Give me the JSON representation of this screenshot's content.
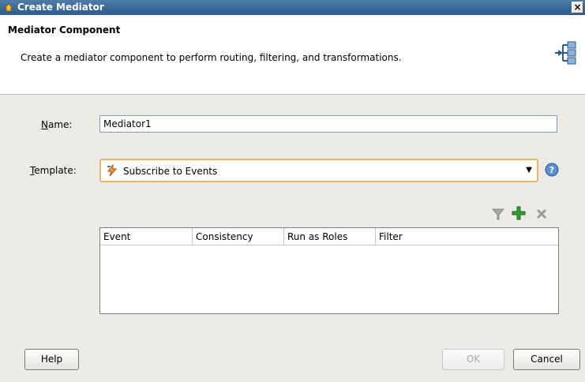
{
  "window": {
    "title": "Create Mediator",
    "close_glyph": "×"
  },
  "header": {
    "title": "Mediator Component",
    "description": "Create a mediator component to perform routing, filtering, and transformations.",
    "icon": "mediator-component-icon"
  },
  "form": {
    "name_label_accel": "N",
    "name_label_rest": "ame:",
    "name_value": "Mediator1",
    "template_label_accel": "T",
    "template_label_rest": "emplate:",
    "template_value": "Subscribe to Events",
    "template_icon": "subscribe-events-icon"
  },
  "toolbar": {
    "icons": [
      "filter-icon",
      "add-icon",
      "delete-icon"
    ]
  },
  "table": {
    "columns": [
      "Event",
      "Consistency",
      "Run as Roles",
      "Filter"
    ],
    "rows": []
  },
  "buttons": {
    "help": "Help",
    "ok": "OK",
    "cancel": "Cancel"
  },
  "colors": {
    "titlebar": "#2d5a8a",
    "combo_focus_border": "#e8b66a",
    "add_green": "#2ea02e"
  }
}
